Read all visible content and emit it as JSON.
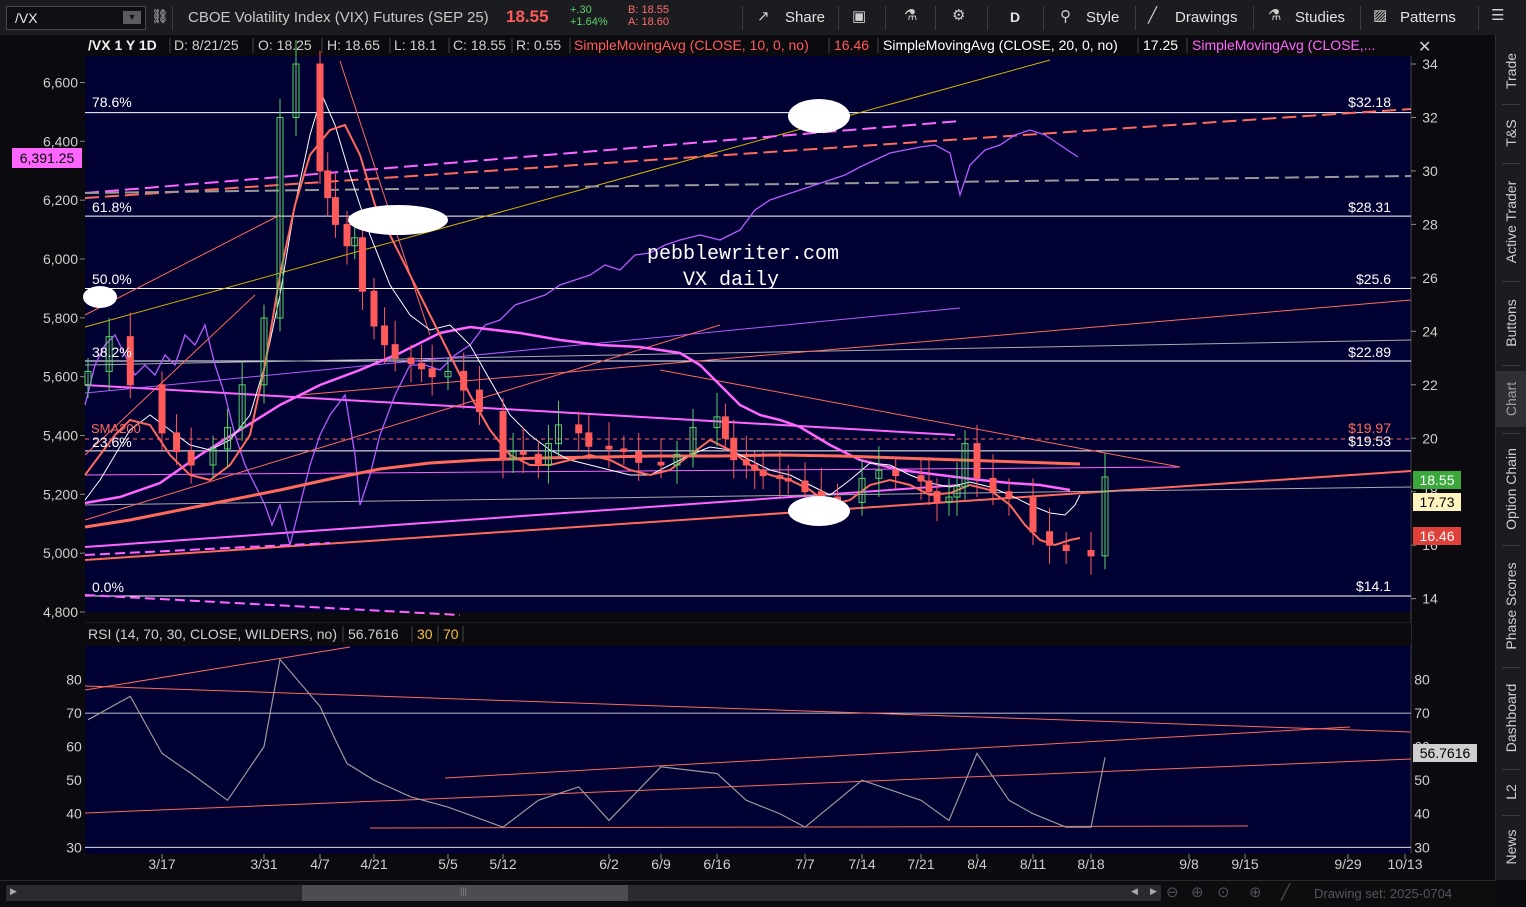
{
  "toolbar": {
    "symbol": "/VX",
    "description": "CBOE Volatility Index (VIX) Futures (SEP 25)",
    "last": "18.55",
    "change": "+.30",
    "change_pct": "+1.64%",
    "bid": "B: 18.55",
    "ask": "A: 18.60",
    "share_label": "Share",
    "period_label": "D",
    "style_label": "Style",
    "drawings_label": "Drawings",
    "studies_label": "Studies",
    "patterns_label": "Patterns"
  },
  "sidebar": {
    "tabs": [
      "Trade",
      "T&S",
      "Active Trader",
      "Buttons",
      "Chart",
      "Option Chain",
      "Phase Scores",
      "Dashboard",
      "L2",
      "News"
    ],
    "active": "Chart"
  },
  "header": {
    "title": "/VX 1 Y 1D",
    "date": "D: 8/21/25",
    "open": "O: 18.25",
    "high": "H: 18.65",
    "low": "L: 18.1",
    "close": "C: 18.55",
    "range": "R: 0.55",
    "sma10": "SimpleMovingAvg (CLOSE, 10, 0, no)",
    "sma10_val": "16.46",
    "sma20": "SimpleMovingAvg (CLOSE, 20, 0, no)",
    "sma20_val": "17.25",
    "sma_more": "SimpleMovingAvg (CLOSE,..."
  },
  "watermark": {
    "line1": "pebblewriter.com",
    "line2": "VX daily"
  },
  "labels": {
    "sma200": "SMA200",
    "left_price_badge": "6,391.25",
    "fib_786": "78.6%",
    "fib_618": "61.8%",
    "fib_500": "50.0%",
    "fib_382": "38.2%",
    "fib_236": "23.6%",
    "fib_000": "0.0%",
    "lvl_3218": "$32.18",
    "lvl_2831": "$28.31",
    "lvl_256": "$25.6",
    "lvl_2289": "$22.89",
    "lvl_1997": "$19.97",
    "lvl_1953": "$19.53",
    "lvl_141": "$14.1",
    "badge_last": "18.55",
    "badge_sma20": "17.73",
    "badge_sma10": "16.46",
    "rsi_title": "RSI (14, 70, 30, CLOSE, WILDERS, no)",
    "rsi_val": "56.7616",
    "rsi_os": "30",
    "rsi_ob": "70",
    "rsi_badge": "56.7616"
  },
  "bottom": {
    "drawing_set": "Drawing set: 2025-0704"
  },
  "colors": {
    "bg": "#000033",
    "up": "#56d364",
    "down": "#ff5b5b",
    "sma10": "#ff6a5a",
    "sma20": "#ffffff",
    "sma50": "#ff66ff",
    "spx": "#b45cff",
    "rsi": "#9a9a9a"
  },
  "chart_data": [
    {
      "type": "line",
      "title": "/VX 1 Y 1D",
      "x_ticks": [
        "3/17",
        "3/31",
        "4/7",
        "4/21",
        "5/5",
        "5/12",
        "6/2",
        "6/9",
        "6/16",
        "7/7",
        "7/14",
        "7/21",
        "8/4",
        "8/11",
        "8/18",
        "9/8",
        "9/15",
        "9/29",
        "10/13"
      ],
      "y_right_ticks": [
        14,
        16,
        18,
        20,
        22,
        24,
        26,
        28,
        30,
        32,
        34
      ],
      "y_left_ticks": [
        "4,800",
        "5,000",
        "5,200",
        "5,400",
        "5,600",
        "5,800",
        "6,000",
        "6,200",
        "6,400",
        "6,600"
      ],
      "ylim_right": [
        13.5,
        34.3
      ],
      "ylim_left": [
        4800,
        6690
      ],
      "fib_levels": [
        {
          "label": "78.6%",
          "price": 32.18
        },
        {
          "label": "61.8%",
          "price": 28.31
        },
        {
          "label": "50.0%",
          "price": 25.6
        },
        {
          "label": "38.2%",
          "price": 22.89
        },
        {
          "label": "23.6%",
          "price": 19.53
        },
        {
          "label": "0.0%",
          "price": 14.1
        }
      ],
      "series": [
        {
          "name": "VX close",
          "x": [
            "3/10",
            "3/12",
            "3/14",
            "3/17",
            "3/19",
            "3/21",
            "3/24",
            "3/26",
            "3/28",
            "3/31",
            "4/2",
            "4/4",
            "4/7",
            "4/9",
            "4/11",
            "4/14",
            "4/16",
            "4/18",
            "4/21",
            "4/23",
            "4/25",
            "4/28",
            "4/30",
            "5/2",
            "5/5",
            "5/7",
            "5/9",
            "5/12",
            "5/14",
            "5/16",
            "5/19",
            "5/21",
            "5/23",
            "5/27",
            "5/29",
            "6/2",
            "6/4",
            "6/6",
            "6/9",
            "6/11",
            "6/13",
            "6/16",
            "6/18",
            "6/20",
            "6/23",
            "6/25",
            "6/27",
            "7/1",
            "7/3",
            "7/7",
            "7/9",
            "7/11",
            "7/14",
            "7/16",
            "7/18",
            "7/21",
            "7/23",
            "7/25",
            "7/28",
            "7/30",
            "8/1",
            "8/4",
            "8/6",
            "8/8",
            "8/11",
            "8/13",
            "8/15",
            "8/18",
            "8/21"
          ],
          "values": [
            22.5,
            23.8,
            22.0,
            20.2,
            19.5,
            19.0,
            19.6,
            20.4,
            22.0,
            24.5,
            32.0,
            34.0,
            30.0,
            29.0,
            28.0,
            27.2,
            27.5,
            25.5,
            24.2,
            23.5,
            23.0,
            22.8,
            22.6,
            22.3,
            22.5,
            21.8,
            21.0,
            19.2,
            19.5,
            19.4,
            19.0,
            19.8,
            20.5,
            20.2,
            19.7,
            19.6,
            19.5,
            19.1,
            19.0,
            19.4,
            20.4,
            20.8,
            20.0,
            19.2,
            19.0,
            18.8,
            18.6,
            18.5,
            18.4,
            18.0,
            17.8,
            17.6,
            18.5,
            18.8,
            18.6,
            18.4,
            18.0,
            17.6,
            17.8,
            18.2,
            19.8,
            18.5,
            18.0,
            17.8,
            16.5,
            16.0,
            15.8,
            15.6,
            18.55
          ]
        },
        {
          "name": "SimpleMovingAvg (CLOSE, 10, 0, no)",
          "x": [
            "3/17",
            "3/31",
            "4/7",
            "4/14",
            "4/21",
            "5/5",
            "5/12",
            "6/2",
            "6/16",
            "7/7",
            "7/21",
            "8/4",
            "8/11",
            "8/18",
            "8/21"
          ],
          "values": [
            20.5,
            22.5,
            28.5,
            29.5,
            27.0,
            23.3,
            20.0,
            19.4,
            19.2,
            18.6,
            18.3,
            17.8,
            16.6,
            15.9,
            16.46
          ]
        },
        {
          "name": "SimpleMovingAvg (CLOSE, 20, 0, no)",
          "x": [
            "3/17",
            "3/31",
            "4/7",
            "4/14",
            "4/21",
            "5/5",
            "5/12",
            "6/2",
            "6/16",
            "7/7",
            "7/21",
            "8/4",
            "8/11",
            "8/18",
            "8/21"
          ],
          "values": [
            19.5,
            20.5,
            25.0,
            27.5,
            27.0,
            25.0,
            22.8,
            20.2,
            19.6,
            19.0,
            18.5,
            18.3,
            17.6,
            16.8,
            17.73
          ]
        }
      ]
    },
    {
      "type": "line",
      "title": "RSI (14, 70, 30, CLOSE, WILDERS, no)",
      "ylim": [
        28,
        90
      ],
      "y_ticks": [
        30,
        40,
        50,
        60,
        70,
        80
      ],
      "series": [
        {
          "name": "RSI",
          "x": [
            "3/10",
            "3/14",
            "3/17",
            "3/21",
            "3/26",
            "3/31",
            "4/2",
            "4/7",
            "4/11",
            "4/14",
            "4/21",
            "4/28",
            "5/5",
            "5/12",
            "5/19",
            "5/27",
            "6/2",
            "6/9",
            "6/16",
            "6/23",
            "7/1",
            "7/7",
            "7/14",
            "7/21",
            "7/28",
            "8/4",
            "8/8",
            "8/11",
            "8/15",
            "8/18",
            "8/21"
          ],
          "values": [
            68,
            75,
            58,
            52,
            44,
            60,
            86,
            72,
            62,
            55,
            50,
            45,
            42,
            36,
            44,
            48,
            38,
            54,
            52,
            44,
            40,
            36,
            50,
            44,
            38,
            58,
            44,
            40,
            36,
            36,
            56.76
          ]
        }
      ]
    }
  ]
}
